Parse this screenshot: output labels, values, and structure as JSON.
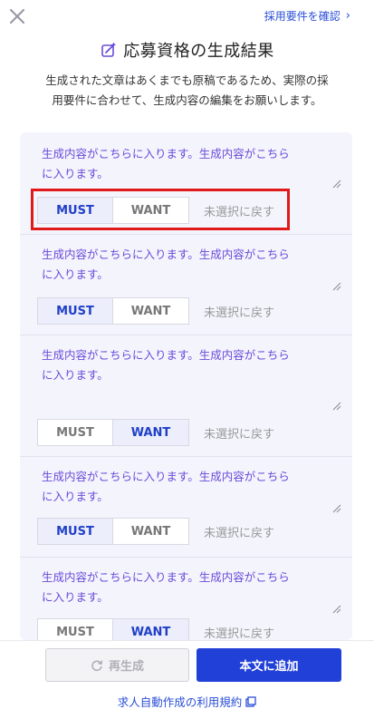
{
  "header": {
    "requirements_link": "採用要件を確認",
    "title": "応募資格の生成結果",
    "description_line1": "生成された文章はあくまでも原稿であるため、実際の採",
    "description_line2": "用要件に合わせて、生成内容の編集をお願いします。"
  },
  "items": [
    {
      "text_line1": "生成内容がこちらに入ります。生成内容がこちら",
      "text_line2": "に入ります。",
      "must": "MUST",
      "want": "WANT",
      "reset": "未選択に戻す",
      "selected": "MUST"
    },
    {
      "text_line1": "生成内容がこちらに入ります。生成内容がこちら",
      "text_line2": "に入ります。",
      "must": "MUST",
      "want": "WANT",
      "reset": "未選択に戻す",
      "selected": "MUST"
    },
    {
      "text_line1": "生成内容がこちらに入ります。生成内容がこちら",
      "text_line2": "に入ります。",
      "must": "MUST",
      "want": "WANT",
      "reset": "未選択に戻す",
      "selected": "WANT"
    },
    {
      "text_line1": "生成内容がこちらに入ります。生成内容がこちら",
      "text_line2": "に入ります。",
      "must": "MUST",
      "want": "WANT",
      "reset": "未選択に戻す",
      "selected": "MUST"
    },
    {
      "text_line1": "生成内容がこちらに入ります。生成内容がこちら",
      "text_line2": "に入ります。",
      "must": "MUST",
      "want": "WANT",
      "reset": "未選択に戻す",
      "selected": "WANT"
    }
  ],
  "footer": {
    "regenerate": "再生成",
    "add_to_body": "本文に追加",
    "terms": "求人自動作成の利用規約"
  },
  "colors": {
    "accent": "#2140d8",
    "generated_text": "#6a4bd8",
    "highlight": "#e01919",
    "list_bg": "#f4f4fd"
  },
  "icons": [
    "close-icon",
    "chevron-right-icon",
    "sparkle-edit-icon",
    "resize-handle-icon",
    "refresh-icon",
    "external-link-icon"
  ]
}
